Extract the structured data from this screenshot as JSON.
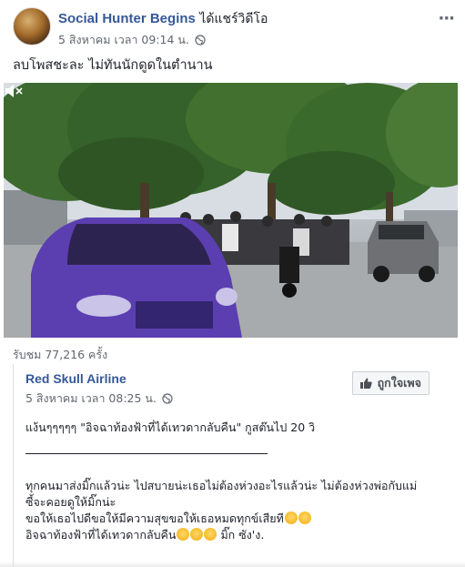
{
  "post": {
    "author": "Social Hunter Begins",
    "action": " ได้แชร์วิดีโอ",
    "timestamp": "5 สิงหาคม เวลา 09:14 น.",
    "caption": "ลบโพสชะละ ไม่ทันนักดูดในตำนาน",
    "more_label": "···",
    "views": "รับชม 77,216 ครั้ง"
  },
  "shared": {
    "page_name": "Red Skull Airline",
    "timestamp": "5 สิงหาคม เวลา 08:25 น.",
    "like_page_label": "ถูกใจเพจ",
    "line1": "แง้นๆๆๆๆๆ \"อิจฉาท้องฟ้าที่ได้เทวดากลับคืน\" กูสต๊นไป 20 วิ",
    "line2": "ทุกคนมาส่งมิ๊กแล้วน่ะ ไปสบายน่ะเธอไม่ต้องห่วงอะไรแล้วน่ะ ไม่ต้องห่วงพ่อกับแม่",
    "line3": "ซี้จะคอยดูให้มิ๊กน่ะ",
    "line4": "ขอให้เธอไปดีขอให้มีความสุขขอให้เธอหมดทุกข์เสียที",
    "line5": "อิจฉาท้องฟ้าที่ได้เทวดากลับคืน",
    "line5_suffix": " มิ๊ก ซัง'ง."
  },
  "icons": [
    "globe-icon",
    "volume-muted-icon",
    "like-thumb-icon"
  ],
  "colors": {
    "link": "#365899",
    "meta": "#616770",
    "car": "#5b3fb0"
  }
}
